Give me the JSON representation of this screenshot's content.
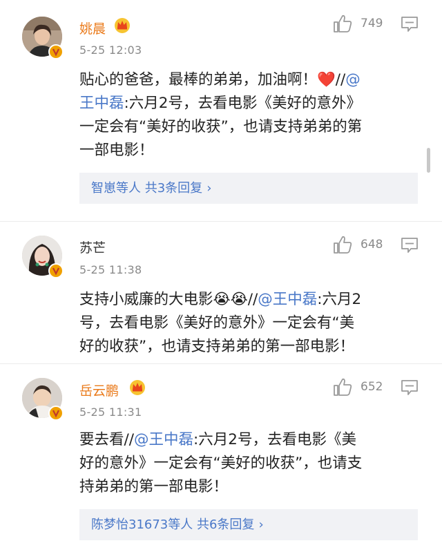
{
  "comments": [
    {
      "user": "姚晨",
      "time": "5-25 12:03",
      "likes": "749",
      "text_pre": "贴心的爸爸，最棒的弟弟，加油啊！",
      "heart": "❤️",
      "text_sep": "//",
      "mention1": "@",
      "mention2": "王中磊",
      "text_post": ":六月2号，去看电影《美好的意外》\n一定会有“美好的收获”，也请支持弟弟的第\n一部电影！",
      "replies": "智崽等人 共3条回复",
      "reply_chevron": "›"
    },
    {
      "user": "苏芒",
      "time": "5-25 11:38",
      "likes": "648",
      "text_pre": "支持小威廉的大电影",
      "emoji": "😭😭",
      "text_sep": "//",
      "mention": "@王中磊",
      "text_post": ":六月2\n号，去看电影《美好的意外》一定会有“美\n好的收获”，也请支持弟弟的第一部电影！"
    },
    {
      "user": "岳云鹏",
      "time": "5-25 11:31",
      "likes": "652",
      "text_pre": "要去看//",
      "mention": "@王中磊",
      "text_post": ":六月2号，去看电影《美\n好的意外》一定会有“美好的收获”，也请支\n持弟弟的第一部电影！",
      "replies": "陈梦怡31673等人 共6条回复",
      "reply_chevron": "›"
    }
  ],
  "colors": {
    "name_orange": "#ea7a1a",
    "link_blue": "#4a78c8",
    "meta_gray": "#8a8a8a",
    "reply_bg": "#f1f2f5"
  },
  "icons": [
    "thumbs-up-icon",
    "comment-reply-icon",
    "crown-badge-icon",
    "verified-v-icon",
    "heart-icon"
  ]
}
